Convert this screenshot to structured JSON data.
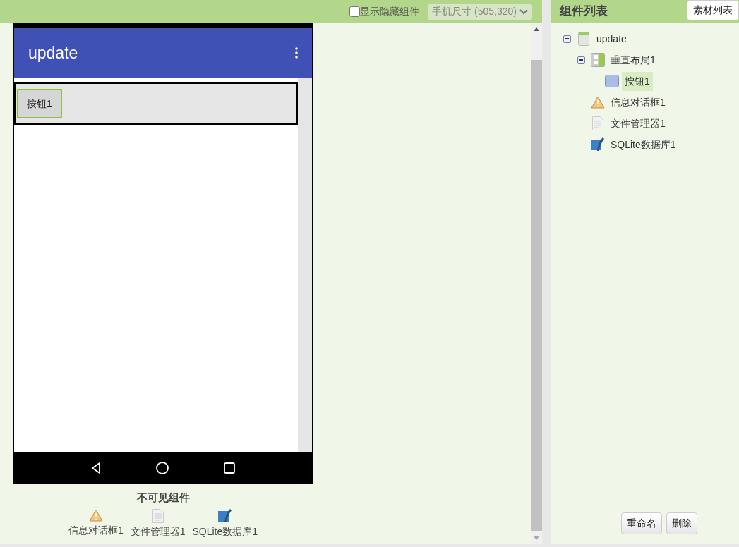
{
  "toolbar": {
    "show_hidden": {
      "label": "显示隐藏组件",
      "checked": false
    },
    "size_select": {
      "value": "手机尺寸 (505,320)"
    }
  },
  "phone": {
    "title": "update",
    "components": [
      {
        "kind": "button",
        "label": "按钮1",
        "selected": true
      }
    ]
  },
  "nonvisible": {
    "title": "不可见组件",
    "items": [
      {
        "kind": "notifier",
        "label": "信息对话框1"
      },
      {
        "kind": "file",
        "label": "文件管理器1"
      },
      {
        "kind": "database",
        "label": "SQLite数据库1"
      }
    ]
  },
  "panel": {
    "title": "组件列表",
    "assets_button": "素材列表",
    "tree": [
      {
        "kind": "screen",
        "label": "update",
        "expanded": true,
        "selected": false,
        "children": [
          {
            "kind": "arrangement",
            "label": "垂直布局1",
            "expanded": true,
            "selected": false,
            "children": [
              {
                "kind": "button",
                "label": "按钮1",
                "selected": true
              }
            ]
          },
          {
            "kind": "notifier",
            "label": "信息对话框1",
            "selected": false
          },
          {
            "kind": "file",
            "label": "文件管理器1",
            "selected": false
          },
          {
            "kind": "database",
            "label": "SQLite数据库1",
            "selected": false
          }
        ]
      }
    ],
    "buttons": [
      "重命名",
      "删除"
    ]
  }
}
